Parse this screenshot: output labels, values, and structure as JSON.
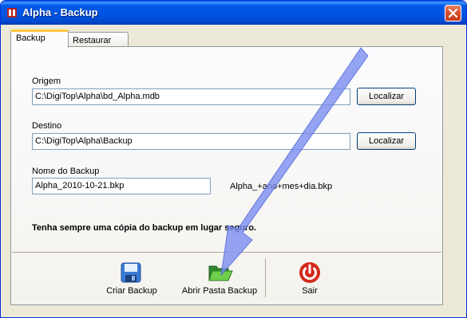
{
  "window": {
    "title": "Alpha - Backup",
    "icons": {
      "app": "app-icon",
      "close": "close-icon"
    }
  },
  "tabs": [
    {
      "label": "Backup",
      "active": true
    },
    {
      "label": "Restaurar",
      "active": false
    }
  ],
  "form": {
    "origem": {
      "label": "Origem",
      "value": "C:\\DigiTop\\Alpha\\bd_Alpha.mdb",
      "button": "Localizar"
    },
    "destino": {
      "label": "Destino",
      "value": "C:\\DigiTop\\Alpha\\Backup",
      "button": "Localizar"
    },
    "nome_backup": {
      "label": "Nome do Backup",
      "value": "Alpha_2010-10-21.bkp",
      "hint": "Alpha_+ano+mes+dia.bkp"
    },
    "warning": "Tenha sempre uma cópia do backup em lugar seguro."
  },
  "toolbar": {
    "criar": {
      "label": "Criar Backup",
      "icon": "floppy-disk-icon"
    },
    "abrir": {
      "label": "Abrir Pasta Backup",
      "icon": "open-folder-icon"
    },
    "sair": {
      "label": "Sair",
      "icon": "power-icon"
    }
  },
  "annotation": {
    "icon": "pointer-arrow",
    "color": "#7b8ff0"
  }
}
